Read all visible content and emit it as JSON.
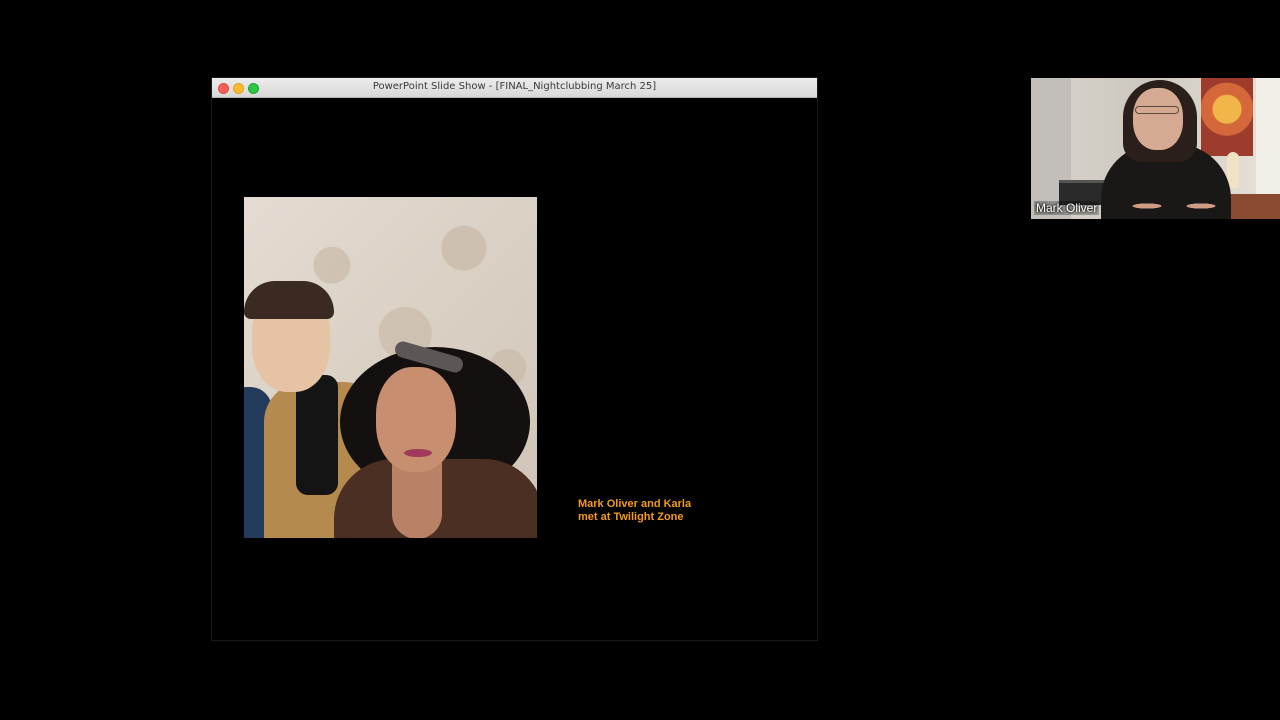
{
  "window": {
    "title": "PowerPoint Slide Show - [FINAL_Nightclubbing March 25]"
  },
  "slide": {
    "caption_line1": "Mark Oliver and Karla",
    "caption_line2": "met at Twilight Zone",
    "caption_color": "#f39a1a"
  },
  "participant": {
    "name": "Mark Oliver"
  },
  "icons": {
    "close": "close-traffic-light",
    "minimize": "minimize-traffic-light",
    "maximize": "maximize-traffic-light"
  }
}
